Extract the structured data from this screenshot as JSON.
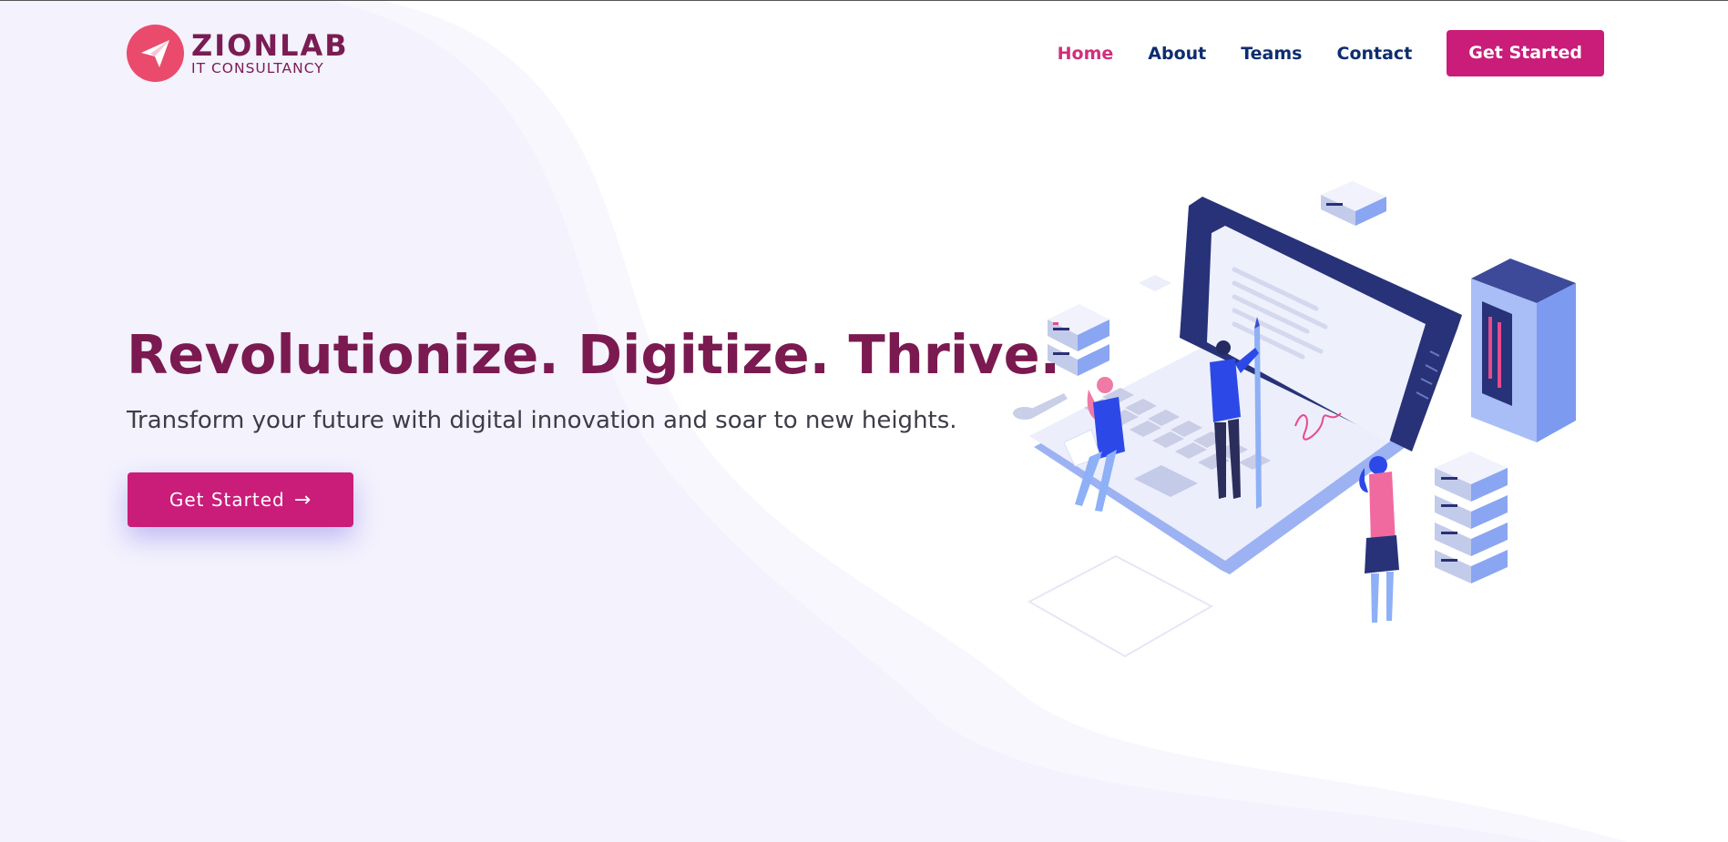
{
  "brand": {
    "name": "ZIONLAB",
    "tagline": "IT CONSULTANCY",
    "logo_icon": "paper-plane-icon",
    "primary_color": "#c91d79",
    "title_color": "#7a1a50",
    "nav_color": "#0d2d6e"
  },
  "nav": {
    "items": [
      {
        "label": "Home",
        "active": true
      },
      {
        "label": "About",
        "active": false
      },
      {
        "label": "Teams",
        "active": false
      },
      {
        "label": "Contact",
        "active": false
      }
    ],
    "cta_label": "Get Started"
  },
  "hero": {
    "title": "Revolutionize. Digitize. Thrive.",
    "subtitle": "Transform your future with digital innovation and soar to new heights.",
    "cta_label": "Get Started",
    "cta_icon": "arrow-right-icon"
  }
}
